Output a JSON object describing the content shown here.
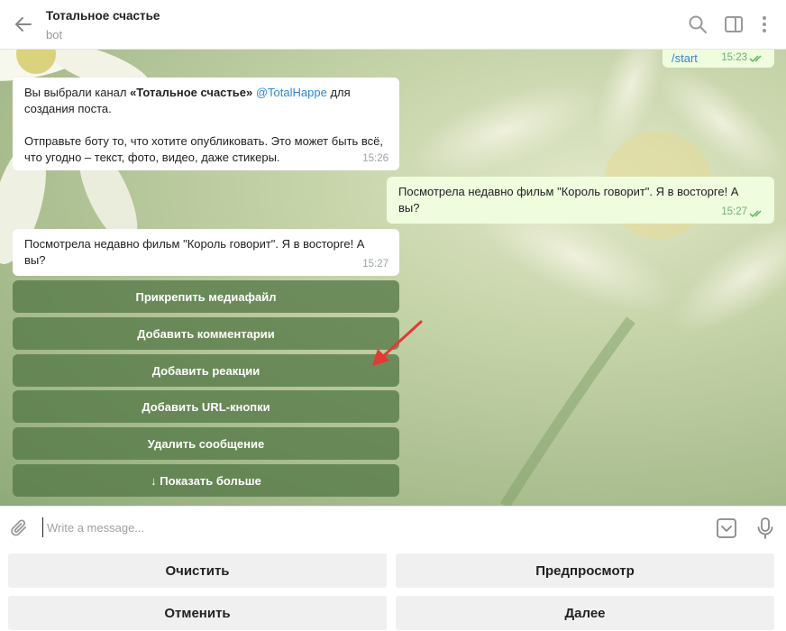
{
  "header": {
    "title": "Тотальное счастье",
    "subtitle": "bot"
  },
  "messages": {
    "start": {
      "text": "/start",
      "time": "15:23"
    },
    "bot_intro": {
      "text_pre": "Вы выбрали канал ",
      "channel_bold": "«Тотальное счастье»",
      "handle": "@TotalHappe",
      "text_post": " для создания поста.",
      "paragraph2": "Отправьте боту то, что хотите опубликовать. Это может быть всё, что угодно – текст, фото, видео, даже стикеры.",
      "time": "15:26"
    },
    "user_post": {
      "text": "Посмотрела недавно фильм \"Король говорит\". Я в восторге! А вы?",
      "time": "15:27"
    },
    "bot_echo": {
      "text": "Посмотрела недавно фильм \"Король говорит\". Я в восторге! А вы?",
      "time": "15:27"
    }
  },
  "inline_keyboard": [
    "Прикрепить медиафайл",
    "Добавить комментарии",
    "Добавить реакции",
    "Добавить URL-кнопки",
    "Удалить сообщение",
    "↓ Показать больше"
  ],
  "composer": {
    "placeholder": "Write a message..."
  },
  "reply_keyboard": [
    "Очистить",
    "Предпросмотр",
    "Отменить",
    "Далее"
  ],
  "colors": {
    "accent": "#2e87d4",
    "outgoing_bubble": "#effdde",
    "inline_button": "#5a7a48",
    "annotation_arrow": "#e53935"
  },
  "icons": [
    "back-arrow-icon",
    "search-icon",
    "sidebar-toggle-icon",
    "more-vertical-icon",
    "paperclip-icon",
    "bot-keyboard-icon",
    "microphone-icon",
    "double-check-icon"
  ]
}
